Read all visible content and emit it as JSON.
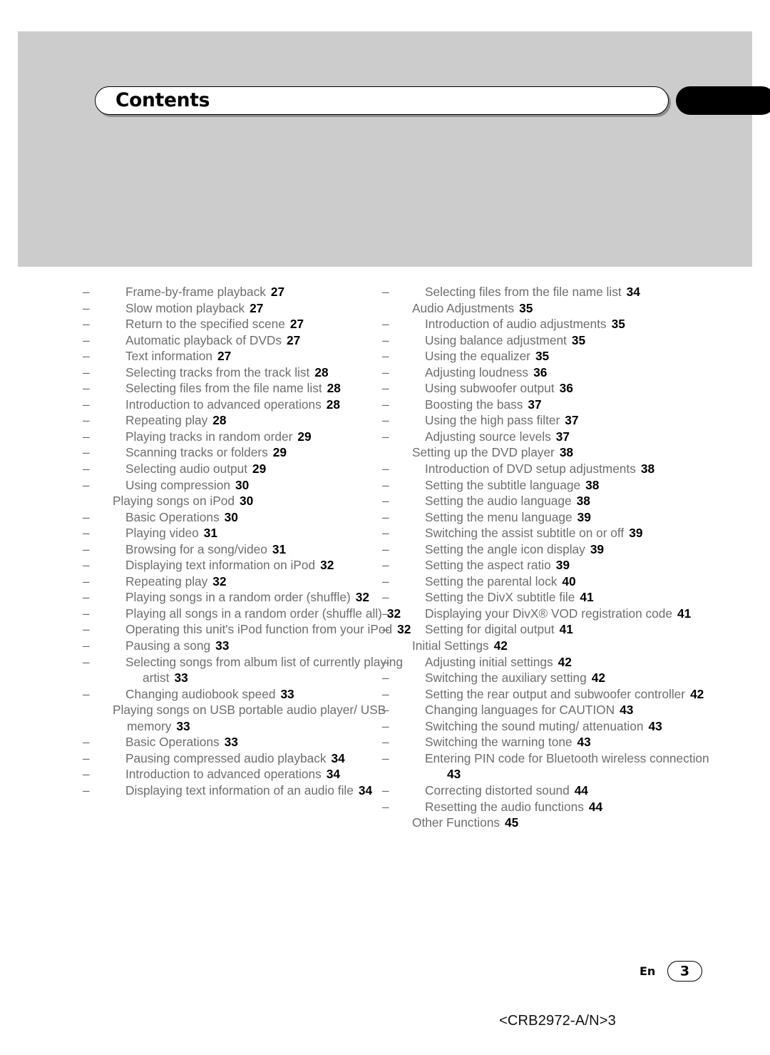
{
  "header": {
    "title": "Contents",
    "band_color": "#cccccc",
    "tab_color": "#000000"
  },
  "toc": {
    "left_column": [
      {
        "level": 2,
        "text": "Frame-by-frame playback",
        "page": "27"
      },
      {
        "level": 2,
        "text": "Slow motion playback",
        "page": "27"
      },
      {
        "level": 2,
        "text": "Return to the specified scene",
        "page": "27"
      },
      {
        "level": 2,
        "text": "Automatic playback of DVDs",
        "page": "27"
      },
      {
        "level": 2,
        "text": "Text information",
        "page": "27"
      },
      {
        "level": 2,
        "text": "Selecting tracks from the track list",
        "page": "28"
      },
      {
        "level": 2,
        "text": "Selecting files from the file name list",
        "page": "28"
      },
      {
        "level": 2,
        "text": "Introduction to advanced operations",
        "page": "28"
      },
      {
        "level": 2,
        "text": "Repeating play",
        "page": "28"
      },
      {
        "level": 2,
        "text": "Playing tracks in random order",
        "page": "29"
      },
      {
        "level": 2,
        "text": "Scanning tracks or folders",
        "page": "29"
      },
      {
        "level": 2,
        "text": "Selecting audio output",
        "page": "29"
      },
      {
        "level": 2,
        "text": "Using compression",
        "page": "30"
      },
      {
        "level": 1,
        "text": "Playing songs on iPod",
        "page": "30"
      },
      {
        "level": 2,
        "text": "Basic Operations",
        "page": "30"
      },
      {
        "level": 2,
        "text": "Playing video",
        "page": "31"
      },
      {
        "level": 2,
        "text": "Browsing for a song/video",
        "page": "31"
      },
      {
        "level": 2,
        "text": "Displaying text information on iPod",
        "page": "32"
      },
      {
        "level": 2,
        "text": "Repeating play",
        "page": "32"
      },
      {
        "level": 2,
        "text": "Playing songs in a random order (shuffle)",
        "page": "32"
      },
      {
        "level": 2,
        "text": "Playing all songs in a random order (shuffle all)",
        "page": "32"
      },
      {
        "level": 2,
        "text": "Operating this unit's iPod function from your iPod",
        "page": "32"
      },
      {
        "level": 2,
        "text": "Pausing a song",
        "page": "33"
      },
      {
        "level": 2,
        "text": "Selecting songs from album list of currently playing artist",
        "page": "33"
      },
      {
        "level": 2,
        "text": "Changing audiobook speed",
        "page": "33"
      },
      {
        "level": 1,
        "text": "Playing songs on USB portable audio player/ USB memory",
        "page": "33"
      },
      {
        "level": 2,
        "text": "Basic Operations",
        "page": "33"
      },
      {
        "level": 2,
        "text": "Pausing compressed audio playback",
        "page": "34"
      },
      {
        "level": 2,
        "text": "Introduction to advanced operations",
        "page": "34"
      },
      {
        "level": 2,
        "text": "Displaying text information of an audio file",
        "page": "34"
      }
    ],
    "right_column": [
      {
        "level": 2,
        "text": "Selecting files from the file name list",
        "page": "34"
      },
      {
        "level": 1,
        "text": "Audio Adjustments",
        "page": "35"
      },
      {
        "level": 2,
        "text": "Introduction of audio adjustments",
        "page": "35"
      },
      {
        "level": 2,
        "text": "Using balance adjustment",
        "page": "35"
      },
      {
        "level": 2,
        "text": "Using the equalizer",
        "page": "35"
      },
      {
        "level": 2,
        "text": "Adjusting loudness",
        "page": "36"
      },
      {
        "level": 2,
        "text": "Using subwoofer output",
        "page": "36"
      },
      {
        "level": 2,
        "text": "Boosting the bass",
        "page": "37"
      },
      {
        "level": 2,
        "text": "Using the high pass filter",
        "page": "37"
      },
      {
        "level": 2,
        "text": "Adjusting source levels",
        "page": "37"
      },
      {
        "level": 1,
        "text": "Setting up the DVD player",
        "page": "38"
      },
      {
        "level": 2,
        "text": "Introduction of DVD setup adjustments",
        "page": "38"
      },
      {
        "level": 2,
        "text": "Setting the subtitle language",
        "page": "38"
      },
      {
        "level": 2,
        "text": "Setting the audio language",
        "page": "38"
      },
      {
        "level": 2,
        "text": "Setting the menu language",
        "page": "39"
      },
      {
        "level": 2,
        "text": "Switching the assist subtitle on or off",
        "page": "39"
      },
      {
        "level": 2,
        "text": "Setting the angle icon display",
        "page": "39"
      },
      {
        "level": 2,
        "text": "Setting the aspect ratio",
        "page": "39"
      },
      {
        "level": 2,
        "text": "Setting the parental lock",
        "page": "40"
      },
      {
        "level": 2,
        "text": "Setting the DivX subtitle file",
        "page": "41"
      },
      {
        "level": 2,
        "text": "Displaying your DivX® VOD registration code",
        "page": "41"
      },
      {
        "level": 2,
        "text": "Setting for digital output",
        "page": "41"
      },
      {
        "level": 1,
        "text": "Initial Settings",
        "page": "42"
      },
      {
        "level": 2,
        "text": "Adjusting initial settings",
        "page": "42"
      },
      {
        "level": 2,
        "text": "Switching the auxiliary setting",
        "page": "42"
      },
      {
        "level": 2,
        "text": "Setting the rear output and subwoofer controller",
        "page": "42"
      },
      {
        "level": 2,
        "text": "Changing languages for CAUTION",
        "page": "43"
      },
      {
        "level": 2,
        "text": "Switching the sound muting/ attenuation",
        "page": "43"
      },
      {
        "level": 2,
        "text": "Switching the warning tone",
        "page": "43"
      },
      {
        "level": 2,
        "text": "Entering PIN code for Bluetooth wireless connection",
        "page": "43"
      },
      {
        "level": 2,
        "text": "Correcting distorted sound",
        "page": "44"
      },
      {
        "level": 2,
        "text": "Resetting the audio functions",
        "page": "44"
      },
      {
        "level": 1,
        "text": "Other Functions",
        "page": "45"
      }
    ]
  },
  "footer": {
    "language_code": "En",
    "page_number": "3",
    "document_code": "<CRB2972-A/N>3"
  }
}
